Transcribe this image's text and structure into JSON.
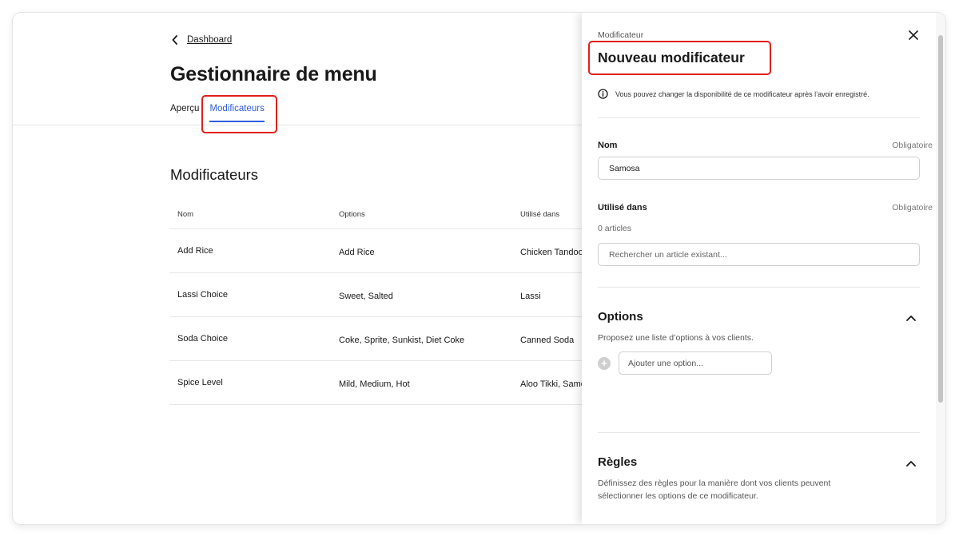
{
  "breadcrumb": {
    "back_label": "Dashboard"
  },
  "page": {
    "title": "Gestionnaire de menu"
  },
  "tabs": [
    {
      "label": "Aperçu"
    },
    {
      "label": "Modificateurs"
    }
  ],
  "section": {
    "title": "Modificateurs"
  },
  "table": {
    "headers": [
      "Nom",
      "Options",
      "Utilisé dans"
    ],
    "rows": [
      [
        "Add Rice",
        "Add Rice",
        "Chicken Tandoo"
      ],
      [
        "Lassi Choice",
        "Sweet, Salted",
        "Lassi"
      ],
      [
        "Soda Choice",
        "Coke, Sprite, Sunkist, Diet Coke",
        "Canned Soda"
      ],
      [
        "Spice Level",
        "Mild, Medium, Hot",
        "Aloo Tikki, Samo"
      ]
    ]
  },
  "panel": {
    "eyebrow": "Modificateur",
    "title": "Nouveau modificateur",
    "info": "Vous pouvez changer la disponibilité de ce modificateur après l’avoir enregistré.",
    "name_label": "Nom",
    "required_label": "Obligatoire",
    "name_value": "Samosa",
    "used_in_label": "Utilisé dans",
    "used_in_count": "0 articles",
    "search_placeholder": "Rechercher un article existant...",
    "options_title": "Options",
    "options_desc": "Proposez une liste d’options à vos clients.",
    "add_option_placeholder": "Ajouter une option...",
    "rules_title": "Règles",
    "rules_desc": "Définissez des règles pour la manière dont vos clients peuvent sélectionner les options de ce modificateur."
  },
  "colors": {
    "accent": "#2f5de0",
    "highlight": "#e0201c"
  },
  "icons": [
    "chevron-left-icon",
    "close-icon",
    "info-icon",
    "chevron-up-icon",
    "plus-circle-icon"
  ]
}
